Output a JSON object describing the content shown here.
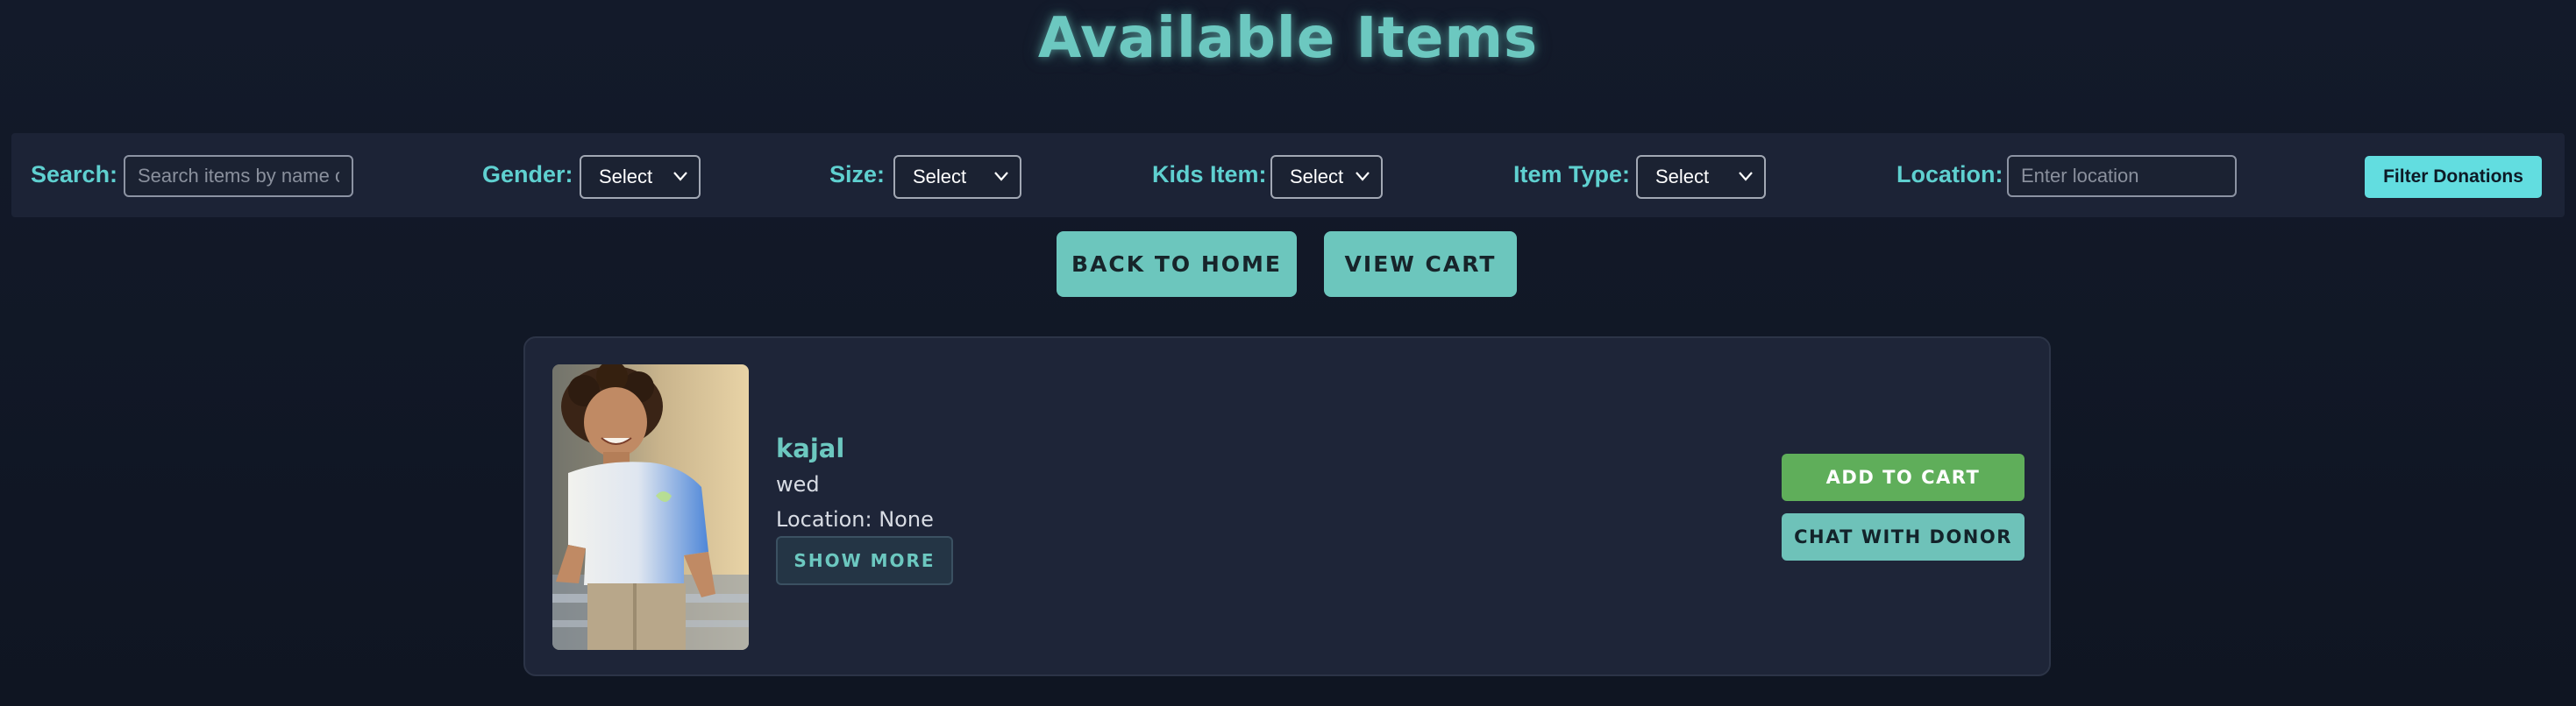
{
  "page": {
    "title": "Available Items"
  },
  "filters": {
    "search_label": "Search:",
    "search_placeholder": "Search items by name o",
    "gender_label": "Gender:",
    "gender_value": "Select",
    "size_label": "Size:",
    "size_value": "Select",
    "kids_label": "Kids Item:",
    "kids_value": "Select",
    "type_label": "Item Type:",
    "type_value": "Select",
    "location_label": "Location:",
    "location_placeholder": "Enter location",
    "filter_button": "Filter Donations"
  },
  "nav": {
    "back_home": "BACK TO HOME",
    "view_cart": "VIEW CART"
  },
  "items": [
    {
      "name": "kajal",
      "description": "wed",
      "location": "Location: None",
      "show_more": "SHOW MORE",
      "add_to_cart": "ADD TO CART",
      "chat": "CHAT WITH DONOR",
      "image_icon": "child-photo"
    }
  ],
  "colors": {
    "accent": "#6cc8c0",
    "filter_button": "#62dde0",
    "add_to_cart": "#5fae5a",
    "background": "#131a2a",
    "card": "#1e2538"
  }
}
